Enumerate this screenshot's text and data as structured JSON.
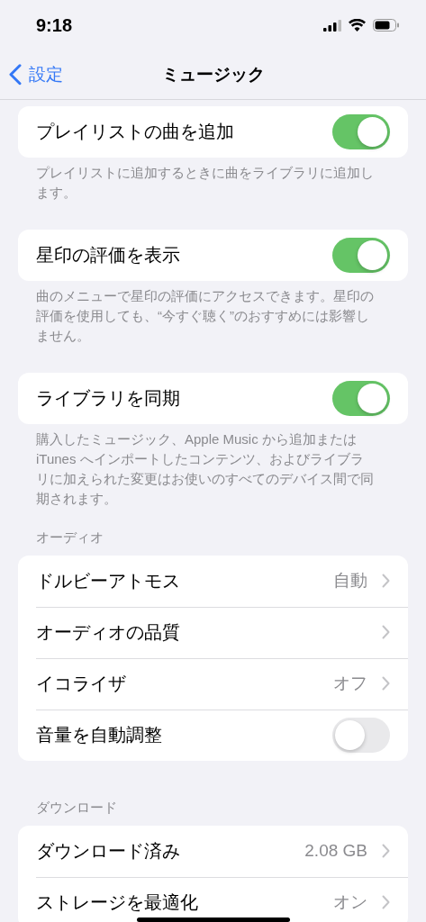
{
  "status_bar": {
    "time": "9:18"
  },
  "nav": {
    "back": "設定",
    "title": "ミュージック"
  },
  "sections": [
    {
      "rows": [
        {
          "kind": "toggle",
          "label": "プレイリストの曲を追加",
          "on": true
        }
      ],
      "footer": "プレイリストに追加するときに曲をライブラリに追加します。"
    },
    {
      "rows": [
        {
          "kind": "toggle",
          "label": "星印の評価を表示",
          "on": true
        }
      ],
      "footer": "曲のメニューで星印の評価にアクセスできます。星印の評価を使用しても、“今すぐ聴く”のおすすめには影響しません。"
    },
    {
      "rows": [
        {
          "kind": "toggle",
          "label": "ライブラリを同期",
          "on": true
        }
      ],
      "footer": "購入したミュージック、Apple Music から追加またはiTunes へインポートしたコンテンツ、およびライブラリに加えられた変更はお使いのすべてのデバイス間で同期されます。"
    },
    {
      "header": "オーディオ",
      "rows": [
        {
          "kind": "detail",
          "label": "ドルビーアトモス",
          "value": "自動"
        },
        {
          "kind": "detail",
          "label": "オーディオの品質"
        },
        {
          "kind": "detail",
          "label": "イコライザ",
          "value": "オフ"
        },
        {
          "kind": "toggle",
          "label": "音量を自動調整",
          "on": false
        }
      ]
    },
    {
      "header": "ダウンロード",
      "rows": [
        {
          "kind": "detail",
          "label": "ダウンロード済み",
          "value": "2.08 GB"
        },
        {
          "kind": "detail",
          "label": "ストレージを最適化",
          "value": "オン"
        }
      ]
    }
  ]
}
